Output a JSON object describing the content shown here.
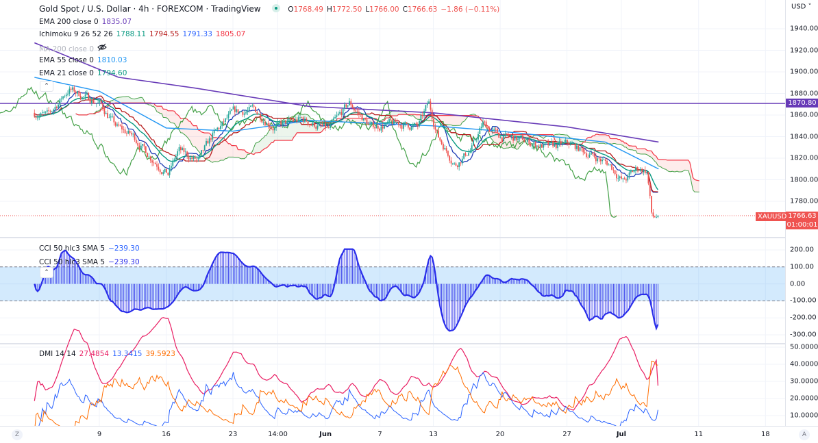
{
  "header": {
    "title": "Gold Spot / U.S. Dollar · 4h · FOREXCOM · TradingView",
    "ohlc": {
      "o_label": "O",
      "o": "1768.49",
      "h_label": "H",
      "h": "1772.50",
      "l_label": "L",
      "l": "1766.00",
      "c_label": "C",
      "c": "1766.63",
      "change": "−1.86 (−0.11%)"
    }
  },
  "legend": {
    "ema200": {
      "label": "EMA 200 close 0",
      "value": "1835.07"
    },
    "ichimoku": {
      "label": "Ichimoku 9 26 52 26",
      "v1": "1788.11",
      "v2": "1794.55",
      "v3": "1791.33",
      "v4": "1805.07"
    },
    "ma200": {
      "label": "MA 200 close 0"
    },
    "ema55": {
      "label": "EMA 55 close 0",
      "value": "1810.03"
    },
    "ema21": {
      "label": "EMA 21 close 0",
      "value": "1794.60"
    },
    "cci1": {
      "label": "CCI 50 hlc3 SMA 5",
      "value": "−239.30"
    },
    "cci2": {
      "label": "CCI 50 hlc3 SMA 5",
      "value": "−239.30"
    },
    "dmi": {
      "label": "DMI 14 14",
      "adx": "27.4854",
      "plus": "13.3415",
      "minus": "39.5923"
    }
  },
  "price_axis": {
    "currency": "USD",
    "labels": [
      "1940.00",
      "1920.00",
      "1900.00",
      "1880.00",
      "1860.00",
      "1840.00",
      "1820.00",
      "1800.00",
      "1780.00"
    ],
    "hline_value": "1870.80",
    "last_symbol": "XAUUSD",
    "last_price": "1766.63",
    "countdown": "01:00:01"
  },
  "cci_axis": {
    "labels": [
      "200.00",
      "100.00",
      "0.00",
      "-100.00",
      "-200.00",
      "-300.00"
    ]
  },
  "dmi_axis": {
    "labels": [
      "50.0000",
      "40.0000",
      "30.0000",
      "20.0000",
      "10.0000"
    ]
  },
  "time_axis": {
    "ticks": [
      {
        "label": "9",
        "day": 8
      },
      {
        "label": "16",
        "day": 15
      },
      {
        "label": "23",
        "day": 22
      },
      {
        "label": "14:00",
        "day": 26.7
      },
      {
        "label": "Jun",
        "day": 31.7
      },
      {
        "label": "7",
        "day": 37.4
      },
      {
        "label": "13",
        "day": 43
      },
      {
        "label": "20",
        "day": 50
      },
      {
        "label": "27",
        "day": 57
      },
      {
        "label": "Jul",
        "day": 62.7
      },
      {
        "label": "11",
        "day": 70.8
      },
      {
        "label": "18",
        "day": 77.8
      }
    ],
    "left_btn": "Z",
    "right_btn": "A"
  },
  "colors": {
    "up": "#26a69a",
    "down": "#ef5350",
    "ema200": "#673ab7",
    "ema55": "#2196f3",
    "ema21": "#089981",
    "tenkan": "#1e3cb4",
    "kijun": "#b71c1c",
    "spanA": "#43a047",
    "spanB": "#f23645",
    "cci": "#2a2eea",
    "adx": "#e91e63",
    "plus": "#2962ff",
    "minus": "#ff6d00"
  },
  "chart_data": {
    "type": "line",
    "title": "Gold Spot / U.S. Dollar · 4h",
    "xlim_days": [
      -2.4,
      79.9
    ],
    "ylim": [
      1760,
      1950
    ],
    "price_path": [
      [
        1.2,
        1862
      ],
      [
        2.6,
        1859
      ],
      [
        4.8,
        1884
      ],
      [
        6.2,
        1878
      ],
      [
        8,
        1871
      ],
      [
        9.8,
        1849
      ],
      [
        11.6,
        1840
      ],
      [
        13.4,
        1821
      ],
      [
        15.2,
        1805
      ],
      [
        16.3,
        1827
      ],
      [
        18.4,
        1817
      ],
      [
        19.8,
        1840
      ],
      [
        22,
        1862
      ],
      [
        24.2,
        1865
      ],
      [
        26.3,
        1849
      ],
      [
        29.2,
        1856
      ],
      [
        32,
        1846
      ],
      [
        34.2,
        1871
      ],
      [
        36.4,
        1849
      ],
      [
        39.2,
        1852
      ],
      [
        41.4,
        1849
      ],
      [
        42.5,
        1871
      ],
      [
        43.5,
        1840
      ],
      [
        45.3,
        1814
      ],
      [
        47.1,
        1830
      ],
      [
        48.2,
        1852
      ],
      [
        50,
        1840
      ],
      [
        52.1,
        1837
      ],
      [
        55,
        1830
      ],
      [
        57.2,
        1833
      ],
      [
        59.3,
        1824
      ],
      [
        61.5,
        1814
      ],
      [
        62.9,
        1798
      ],
      [
        64.4,
        1811
      ],
      [
        65.4,
        1808
      ],
      [
        65.9,
        1765
      ],
      [
        66.6,
        1766.63
      ]
    ],
    "ema200": [
      [
        1.2,
        1927
      ],
      [
        10,
        1895
      ],
      [
        18,
        1885
      ],
      [
        30,
        1868
      ],
      [
        43,
        1862
      ],
      [
        57,
        1849
      ],
      [
        66.6,
        1835
      ]
    ],
    "ema55": [
      [
        1.2,
        1895
      ],
      [
        8,
        1882
      ],
      [
        15,
        1848
      ],
      [
        22,
        1845
      ],
      [
        30,
        1855
      ],
      [
        43,
        1850
      ],
      [
        50,
        1845
      ],
      [
        61,
        1835
      ],
      [
        66.6,
        1810
      ]
    ],
    "hline": 1870.8,
    "cci_band": [
      -100,
      100
    ],
    "cci_ylim": [
      -320,
      210
    ],
    "dmi_ylim": [
      5,
      52
    ]
  }
}
